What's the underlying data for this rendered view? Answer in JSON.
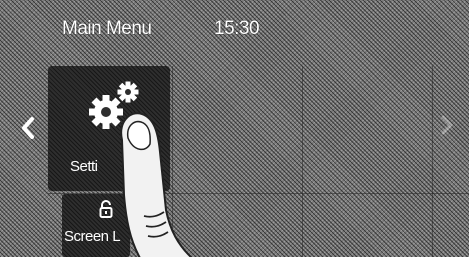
{
  "header": {
    "title": "Main Menu",
    "time": "15:30"
  },
  "nav": {
    "left_arrow": "left-chevron",
    "right_arrow": "right-chevron"
  },
  "tiles": [
    {
      "label": "Setti",
      "icon": "gears-icon"
    },
    {
      "label": "Screen L",
      "icon": "lock-icon"
    }
  ],
  "colors": {
    "background": "#7a7a7a",
    "tile": "#2e2e2e",
    "text": "#ffffff"
  }
}
